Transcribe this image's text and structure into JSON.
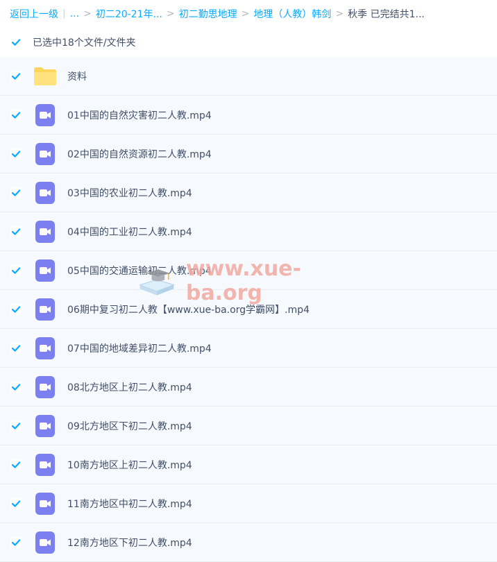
{
  "breadcrumb": {
    "back": "返回上一级",
    "ellipsis": "...",
    "items": [
      "初二20-21年...",
      "初二勤思地理",
      "地理（人教）韩剑"
    ],
    "current": "秋季 已完结共1..."
  },
  "selection": {
    "label": "已选中18个文件/文件夹"
  },
  "files": [
    {
      "name": "资料",
      "type": "folder"
    },
    {
      "name": "01中国的自然灾害初二人教.mp4",
      "type": "video"
    },
    {
      "name": "02中国的自然资源初二人教.mp4",
      "type": "video"
    },
    {
      "name": "03中国的农业初二人教.mp4",
      "type": "video"
    },
    {
      "name": "04中国的工业初二人教.mp4",
      "type": "video"
    },
    {
      "name": "05中国的交通运输初二人教.mp4",
      "type": "video"
    },
    {
      "name": "06期中复习初二人教【www.xue-ba.org学霸网】.mp4",
      "type": "video"
    },
    {
      "name": "07中国的地域差异初二人教.mp4",
      "type": "video"
    },
    {
      "name": "08北方地区上初二人教.mp4",
      "type": "video"
    },
    {
      "name": "09北方地区下初二人教.mp4",
      "type": "video"
    },
    {
      "name": "10南方地区上初二人教.mp4",
      "type": "video"
    },
    {
      "name": "11南方地区中初二人教.mp4",
      "type": "video"
    },
    {
      "name": "12南方地区下初二人教.mp4",
      "type": "video"
    }
  ],
  "watermark": {
    "text": "www.xue-ba.org"
  },
  "colors": {
    "accent": "#09aaff",
    "video_icon": "#7b7ff0",
    "folder_icon": "#ffd65c",
    "row_bg": "#f6faff"
  }
}
